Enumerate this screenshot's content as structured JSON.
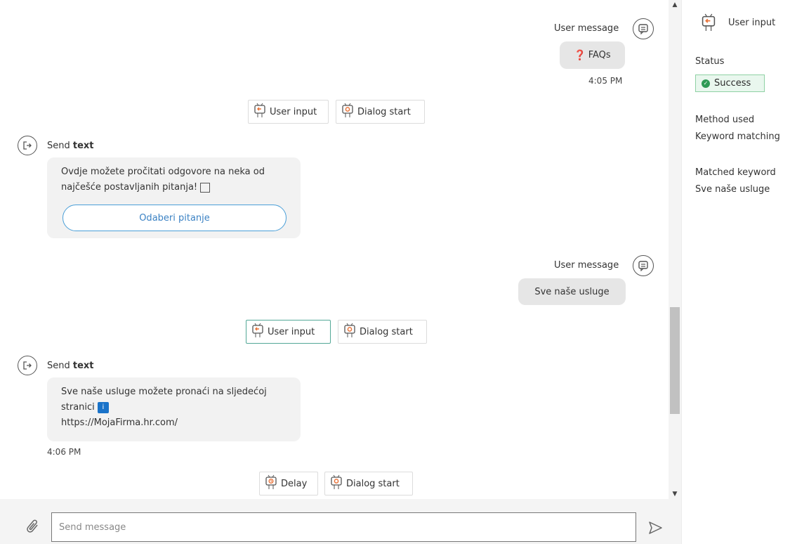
{
  "conversation": {
    "user_message_1": {
      "label": "User message",
      "icon": "chat-bubble-icon",
      "text": "FAQs",
      "time": "4:05 PM"
    },
    "tags_1": [
      {
        "label": "User input",
        "icon": "robot-arrow-icon"
      },
      {
        "label": "Dialog start",
        "icon": "robot-gear-icon"
      }
    ],
    "send_text_1": {
      "label_prefix": "Send",
      "label_bold": "text",
      "icon": "exit-icon",
      "line_1": "Ovdje možete pročitati odgovore na neka od",
      "line_2": "najčešće postavljanih pitanja!",
      "button": "Odaberi pitanje"
    },
    "user_message_2": {
      "label": "User message",
      "icon": "chat-bubble-icon",
      "text": "Sve naše usluge"
    },
    "tags_2": [
      {
        "label": "User input",
        "icon": "robot-arrow-icon"
      },
      {
        "label": "Dialog start",
        "icon": "robot-gear-icon"
      }
    ],
    "send_text_2": {
      "label_prefix": "Send",
      "label_bold": "text",
      "icon": "exit-icon",
      "line_1": "Sve naše usluge možete pronaći na sljedećoj",
      "line_2": "stranici",
      "badge": "i",
      "line_3": "https://MojaFirma.hr.com/",
      "time": "4:06 PM"
    },
    "tags_3": [
      {
        "label": "Delay",
        "icon": "robot-clock-icon"
      },
      {
        "label": "Dialog start",
        "icon": "robot-gear-icon"
      }
    ]
  },
  "composer": {
    "placeholder": "Send message"
  },
  "side_panel": {
    "title": "User input",
    "status_label": "Status",
    "status_value": "Success",
    "method_label": "Method used",
    "method_value": "Keyword matching",
    "keyword_label": "Matched keyword",
    "keyword_value": "Sve naše usluge"
  },
  "colors": {
    "accent_blue": "#4a9fd8",
    "success_green": "#2e9a55",
    "active_tag_border": "#53a897",
    "robot_orange": "#e8743b"
  }
}
